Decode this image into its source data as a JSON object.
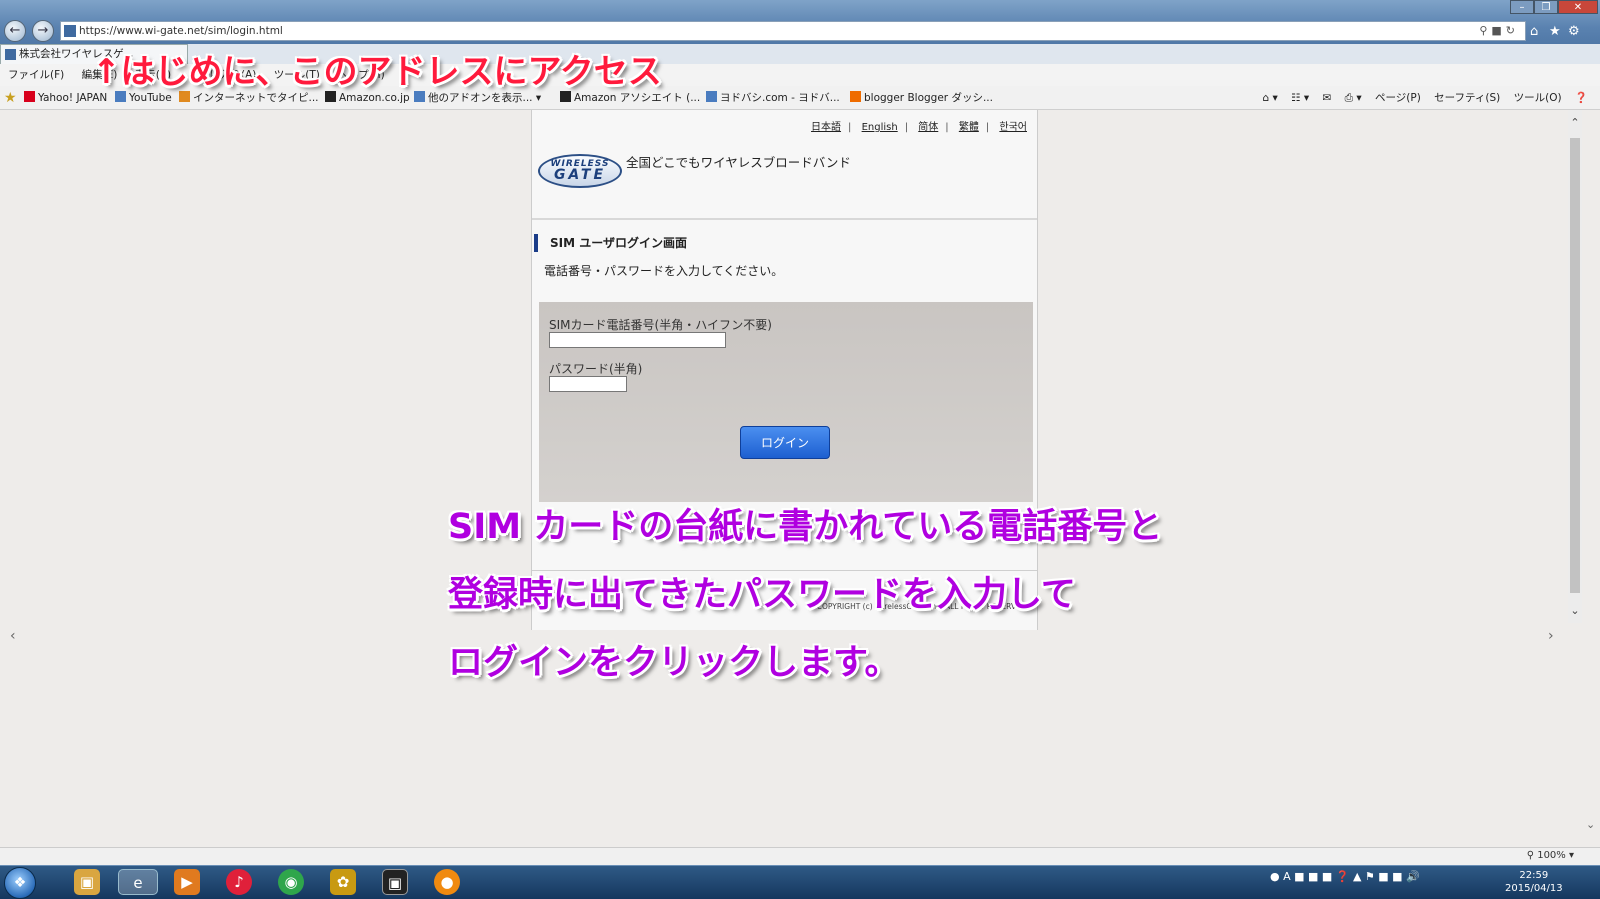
{
  "browser": {
    "url": "https://www.wi-gate.net/sim/login.html",
    "tab_title": "株式会社ワイヤレスゲ...",
    "menu": [
      "ファイル(F)",
      "編集(E)",
      "表示(V)",
      "お気に入り(A)",
      "ツール(T)",
      "ヘルプ(H)"
    ],
    "favorites": [
      "Yahoo! JAPAN",
      "YouTube",
      "インターネットでタイピ...",
      "Amazon.co.jp",
      "他のアドオンを表示...",
      "Amazon アソシエイト (...",
      "ヨドバシ.com - ヨドバ...",
      "blogger Blogger ダッシ..."
    ],
    "commands": [
      "ページ(P)",
      "セーフティ(S)",
      "ツール(O)"
    ],
    "zoom": "100%"
  },
  "page": {
    "lang_links": [
      "日本語",
      "English",
      "简体",
      "繁體",
      "한국어"
    ],
    "logo_line1": "WIRELESS",
    "logo_line2": "GATE",
    "tagline": "全国どこでもワイヤレスブロードバンド",
    "section_title": "SIM ユーザログイン画面",
    "instruction": "電話番号・パスワードを入力してください。",
    "phone_label": "SIMカード電話番号(半角・ハイフン不要)",
    "password_label": "パスワード(半角)",
    "login_button": "ログイン",
    "copyright": "COPYRIGHT (c) WirelessGate, Inc. ALL RIGHT RESERVED."
  },
  "captions": {
    "top": "↑はじめに、このアドレスにアクセス",
    "line1": "SIM カードの台紙に書かれている電話番号と",
    "line2": "登録時に出てきたパスワードを入力して",
    "line3": "ログインをクリックします。"
  },
  "taskbar": {
    "time": "22:59",
    "date": "2015/04/13"
  },
  "colors": {
    "caption_red": "#ff1a3c",
    "caption_purple": "#b000e0",
    "login_button": "#1d5fd0",
    "section_accent": "#1a3c88"
  }
}
